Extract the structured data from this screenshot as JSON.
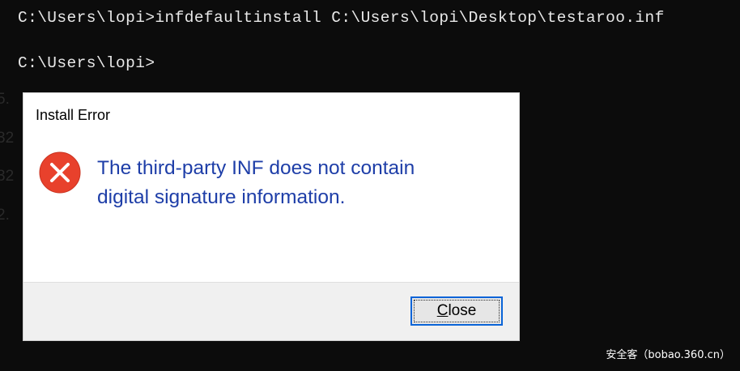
{
  "console": {
    "line1": "C:\\Users\\lopi>infdefaultinstall C:\\Users\\lopi\\Desktop\\testaroo.inf",
    "line2": "C:\\Users\\lopi>"
  },
  "dialog": {
    "title": "Install Error",
    "icon": "error-icon",
    "message_line1": "The third-party INF does not contain",
    "message_line2": "digital signature information.",
    "close_label_first": "C",
    "close_label_rest": "lose",
    "colors": {
      "message_text": "#1e3ea8",
      "error_red": "#e8412c",
      "focus_border": "#0a64d8"
    }
  },
  "watermark": "安全客（bobao.360.cn）"
}
